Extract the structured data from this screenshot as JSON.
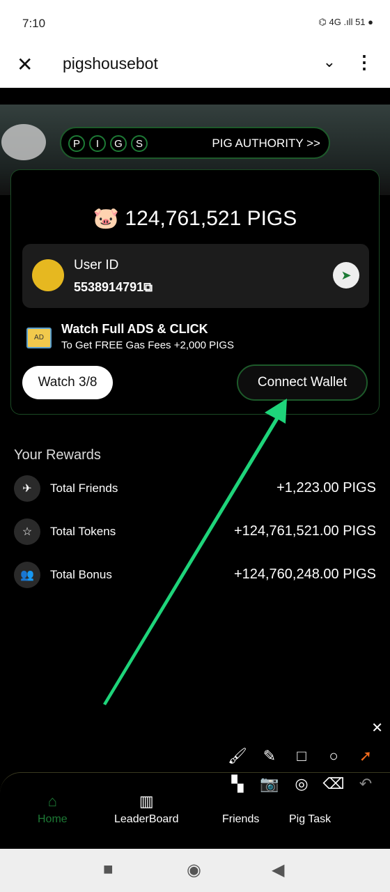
{
  "status": {
    "time": "7:10",
    "icons": "⌬ 4G .ıll 51 ●"
  },
  "appbar": {
    "title": "pigshousebot"
  },
  "header": {
    "letters": [
      "P",
      "I",
      "G",
      "S"
    ],
    "authority": "PIG AUTHORITY >>"
  },
  "card": {
    "balance": "124,761,521 PIGS",
    "user_id_label": "User ID",
    "user_id": "5538914791",
    "ads_title": "Watch Full ADS & CLICK",
    "ads_subtitle": "To Get FREE Gas Fees +2,000 PIGS",
    "ads_icon_text": "AD",
    "watch_label": "Watch 3/8",
    "connect_label": "Connect Wallet"
  },
  "rewards": {
    "title": "Your Rewards",
    "items": [
      {
        "label": "Total Friends",
        "value": "+1,223.00 PIGS",
        "icon": "telegram-icon"
      },
      {
        "label": "Total Tokens",
        "value": "+124,761,521.00 PIGS",
        "icon": "star-icon"
      },
      {
        "label": "Total Bonus",
        "value": "+124,760,248.00 PIGS",
        "icon": "users-icon"
      }
    ]
  },
  "nav": {
    "items": [
      "Home",
      "LeaderBoard",
      "Friends",
      "Pig Task"
    ],
    "active_color": "#1d7a35"
  },
  "colors": {
    "accent": "#1d7a35",
    "arrow": "#1ed47a"
  }
}
